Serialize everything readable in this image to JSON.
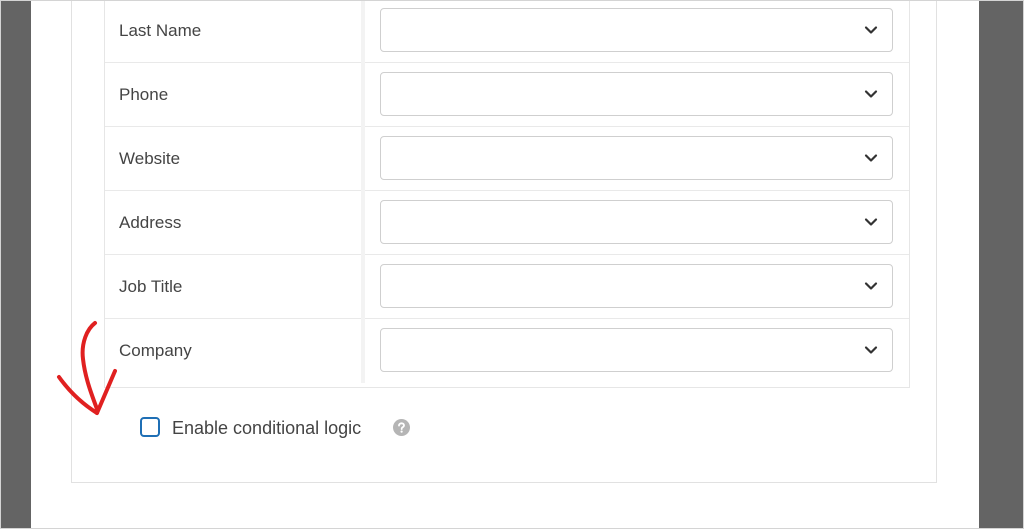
{
  "fields": [
    {
      "label": "Last Name"
    },
    {
      "label": "Phone"
    },
    {
      "label": "Website"
    },
    {
      "label": "Address"
    },
    {
      "label": "Job Title"
    },
    {
      "label": "Company"
    }
  ],
  "conditional_logic": {
    "label": "Enable conditional logic",
    "checked": false
  },
  "icons": {
    "select_chevron": "chevron-down-icon",
    "help": "question-circle-icon",
    "annotation": "red-arrow-icon"
  },
  "colors": {
    "checkbox_border": "#1f6fb5",
    "annotation_arrow": "#e02020",
    "side_bars": "#646464"
  }
}
